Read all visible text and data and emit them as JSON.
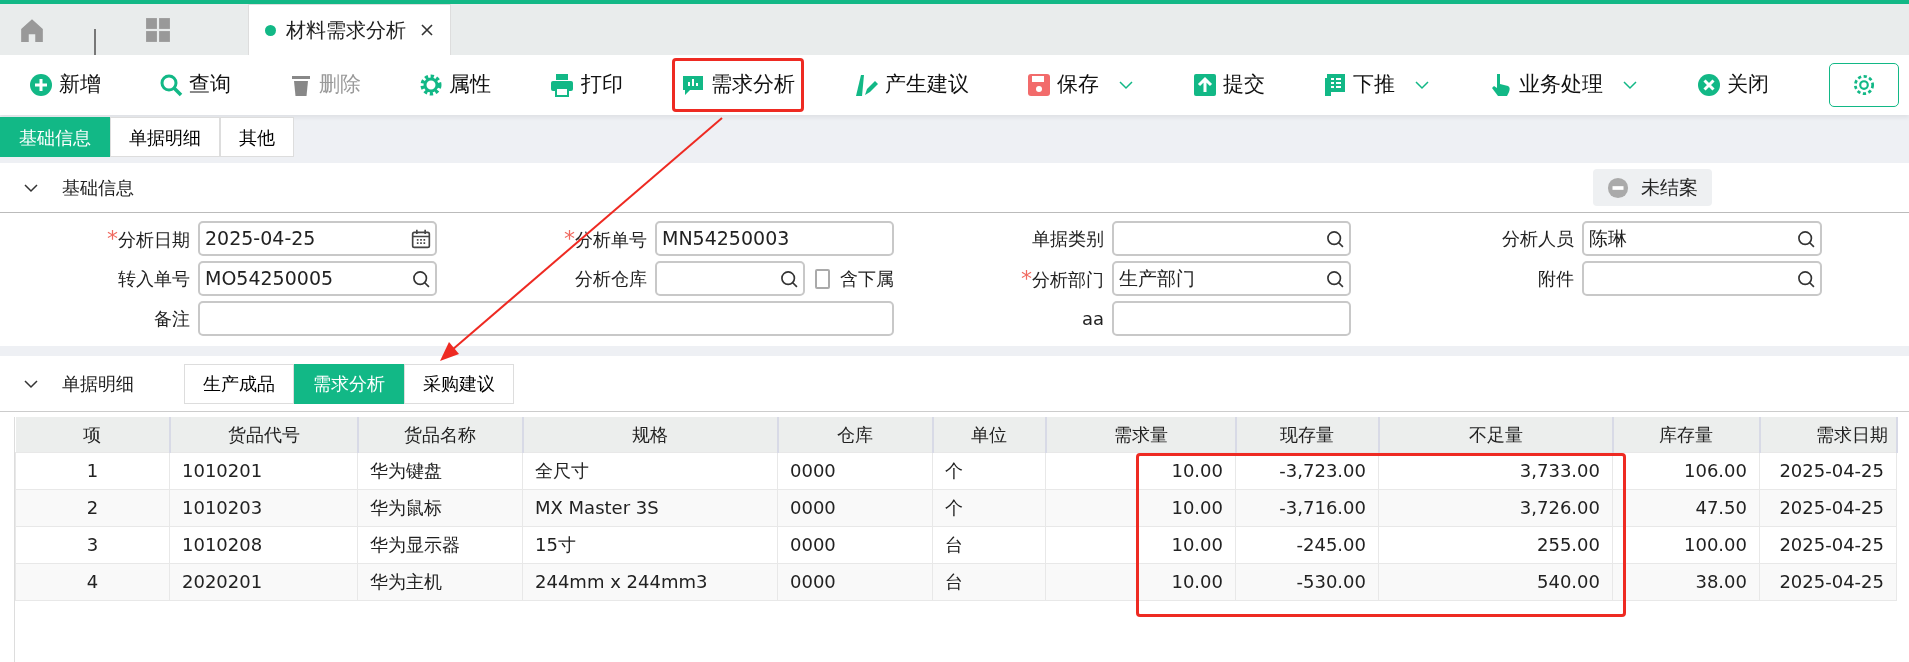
{
  "window_tabs": [
    {
      "label": "材料需求分析",
      "selected": true
    }
  ],
  "toolbar": [
    {
      "label": "新增",
      "kind": "plus",
      "disabled": false,
      "dropdown": false,
      "highlighted": false
    },
    {
      "label": "查询",
      "kind": "search",
      "disabled": false,
      "dropdown": false,
      "highlighted": false
    },
    {
      "label": "删除",
      "kind": "trash",
      "disabled": true,
      "dropdown": false,
      "highlighted": false
    },
    {
      "label": "属性",
      "kind": "gear",
      "disabled": false,
      "dropdown": false,
      "highlighted": false
    },
    {
      "label": "打印",
      "kind": "printer",
      "disabled": false,
      "dropdown": false,
      "highlighted": false
    },
    {
      "label": "需求分析",
      "kind": "chart",
      "disabled": false,
      "dropdown": false,
      "highlighted": true
    },
    {
      "label": "产生建议",
      "kind": "pen",
      "disabled": false,
      "dropdown": false,
      "highlighted": false
    },
    {
      "label": "保存",
      "kind": "floppy",
      "disabled": false,
      "dropdown": true,
      "highlighted": false
    },
    {
      "label": "提交",
      "kind": "upload",
      "disabled": false,
      "dropdown": false,
      "highlighted": false
    },
    {
      "label": "下推",
      "kind": "list",
      "disabled": false,
      "dropdown": true,
      "highlighted": false
    },
    {
      "label": "业务处理",
      "kind": "hand",
      "disabled": false,
      "dropdown": true,
      "highlighted": false
    },
    {
      "label": "关闭",
      "kind": "close",
      "disabled": false,
      "dropdown": false,
      "highlighted": false
    }
  ],
  "form_tabs": [
    {
      "label": "基础信息",
      "selected": true
    },
    {
      "label": "单据明细",
      "selected": false
    },
    {
      "label": "其他",
      "selected": false
    }
  ],
  "basic_section": {
    "title": "基础信息",
    "expanded": true,
    "status": "未结案",
    "rows": [
      [
        {
          "mark": "*",
          "label": "分析日期",
          "kind": "date",
          "value": "2025-04-25"
        },
        {
          "mark": "*",
          "label": "分析单号",
          "kind": "text",
          "value": "MN54250003"
        },
        {
          "label": "单据类别",
          "kind": "lookup"
        },
        {
          "label": "分析人员",
          "kind": "lookup",
          "value": "陈琳"
        }
      ],
      [
        {
          "label": "转入单号",
          "kind": "lookup",
          "value": "MO54250005"
        },
        {
          "label": "分析仓库",
          "kind": "lookup",
          "checkbox": {
            "label": "含下属",
            "checked": false
          }
        },
        {
          "mark": "*",
          "label": "分析部门",
          "kind": "lookup",
          "value": "生产部门"
        },
        {
          "label": "附件",
          "kind": "lookup"
        }
      ],
      [
        {
          "label": "备注",
          "kind": "text",
          "colspan": 2
        },
        {
          "label": "aa",
          "kind": "text"
        }
      ]
    ]
  },
  "detail_section": {
    "title": "单据明细",
    "expanded": true,
    "tabs": [
      {
        "label": "生产成品",
        "selected": false
      },
      {
        "label": "需求分析",
        "selected": true
      },
      {
        "label": "采购建议",
        "selected": false
      }
    ],
    "table": {
      "columns": [
        {
          "label": "项",
          "kind": "index"
        },
        {
          "label": "货品代号",
          "kind": "text"
        },
        {
          "label": "货品名称",
          "kind": "text"
        },
        {
          "label": "规格",
          "kind": "text"
        },
        {
          "label": "仓库",
          "kind": "text"
        },
        {
          "label": "单位",
          "kind": "text"
        },
        {
          "label": "需求量",
          "kind": "number"
        },
        {
          "label": "现存量",
          "kind": "number"
        },
        {
          "label": "不足量",
          "kind": "number"
        },
        {
          "label": "库存量",
          "kind": "number"
        },
        {
          "label": "需求日期",
          "kind": "date"
        }
      ],
      "rows": [
        [
          "1",
          "1010201",
          "华为键盘",
          "全尺寸",
          "0000",
          "个",
          "10.00",
          "-3,723.00",
          "3,733.00",
          "106.00",
          "2025-04-25"
        ],
        [
          "2",
          "1010203",
          "华为鼠标",
          "MX Master 3S",
          "0000",
          "个",
          "10.00",
          "-3,716.00",
          "3,726.00",
          "47.50",
          "2025-04-25"
        ],
        [
          "3",
          "1010208",
          "华为显示器",
          "15寸",
          "0000",
          "台",
          "10.00",
          "-245.00",
          "255.00",
          "100.00",
          "2025-04-25"
        ],
        [
          "4",
          "2020201",
          "华为主机",
          "244mm x 244mm3",
          "0000",
          "台",
          "10.00",
          "-530.00",
          "540.00",
          "38.00",
          "2025-04-25"
        ]
      ]
    }
  }
}
